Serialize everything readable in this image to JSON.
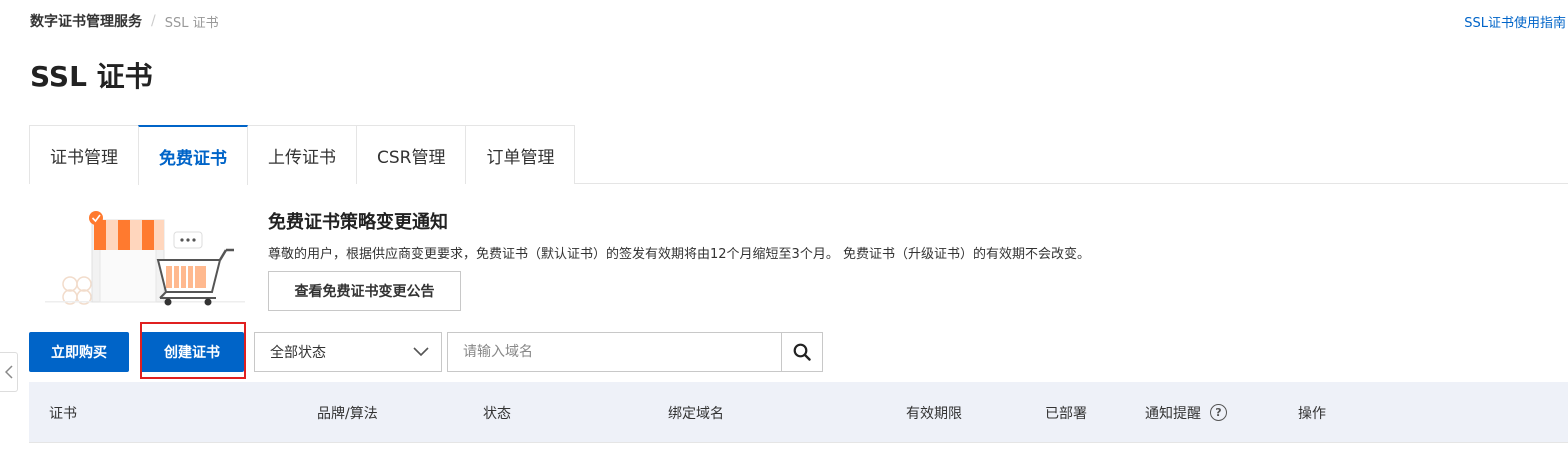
{
  "breadcrumb": {
    "root": "数字证书管理服务",
    "separator": "/",
    "current": "SSL 证书"
  },
  "guide_link": "SSL证书使用指南",
  "page_title": "SSL 证书",
  "tabs": [
    {
      "label": "证书管理",
      "active": false
    },
    {
      "label": "免费证书",
      "active": true
    },
    {
      "label": "上传证书",
      "active": false
    },
    {
      "label": "CSR管理",
      "active": false
    },
    {
      "label": "订单管理",
      "active": false
    }
  ],
  "notice": {
    "title": "免费证书策略变更通知",
    "text": "尊敬的用户，根据供应商变更要求，免费证书（默认证书）的签发有效期将由12个月缩短至3个月。 免费证书（升级证书）的有效期不会改变。",
    "button_label": "查看免费证书变更公告"
  },
  "toolbar": {
    "buy_label": "立即购买",
    "create_label": "创建证书",
    "status_select": "全部状态",
    "search_placeholder": "请输入域名"
  },
  "table": {
    "columns": [
      "证书",
      "品牌/算法",
      "状态",
      "绑定域名",
      "有效期限",
      "已部署",
      "通知提醒",
      "操作"
    ]
  },
  "colors": {
    "primary": "#0064c8",
    "highlight": "#e02020",
    "table_header_bg": "#eef1f8"
  },
  "icons": [
    "chevron-down-icon",
    "search-icon",
    "chevron-left-icon",
    "question-circle-icon",
    "shopping-cart-illustration"
  ]
}
